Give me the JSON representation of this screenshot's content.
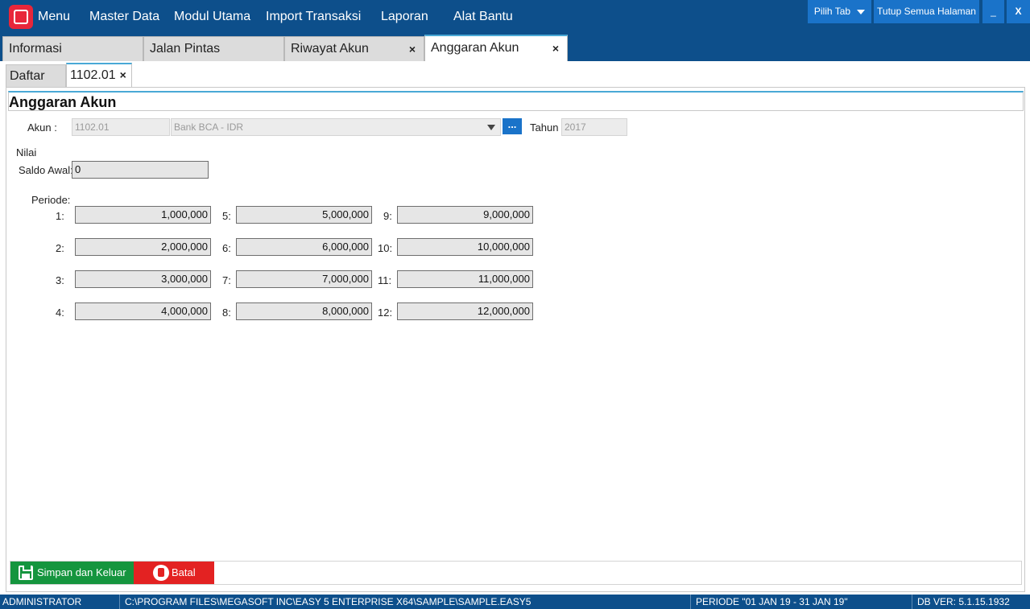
{
  "topbar": {
    "menu_label": "Menu",
    "items": [
      "Master Data",
      "Modul Utama",
      "Import Transaksi",
      "Laporan",
      "Alat Bantu"
    ],
    "pilih_tab": "Pilih Tab",
    "tutup_semua": "Tutup Semua Halaman",
    "minimize": "_",
    "close": "X"
  },
  "main_tabs": [
    {
      "label": "Informasi"
    },
    {
      "label": "Jalan Pintas"
    },
    {
      "label": "Riwayat Akun",
      "close": "×"
    },
    {
      "label": "Anggaran Akun",
      "close": "×"
    }
  ],
  "sub_tabs": [
    {
      "label": "Daftar"
    },
    {
      "label": "1102.01",
      "close": "×"
    }
  ],
  "form": {
    "title": "Anggaran Akun",
    "akun_label": "Akun :",
    "akun_code": "1102.01",
    "akun_name": "Bank BCA - IDR",
    "browse_button": "...",
    "tahun_label": "Tahun",
    "tahun_value": "2017",
    "nilai_label": "Nilai",
    "saldo_awal_label": "Saldo Awal:",
    "saldo_awal_value": "0",
    "periode_label": "Periode:",
    "periods": [
      {
        "label": "1:",
        "value": "1,000,000"
      },
      {
        "label": "2:",
        "value": "2,000,000"
      },
      {
        "label": "3:",
        "value": "3,000,000"
      },
      {
        "label": "4:",
        "value": "4,000,000"
      },
      {
        "label": "5:",
        "value": "5,000,000"
      },
      {
        "label": "6:",
        "value": "6,000,000"
      },
      {
        "label": "7:",
        "value": "7,000,000"
      },
      {
        "label": "8:",
        "value": "8,000,000"
      },
      {
        "label": "9:",
        "value": "9,000,000"
      },
      {
        "label": "10:",
        "value": "10,000,000"
      },
      {
        "label": "11:",
        "value": "11,000,000"
      },
      {
        "label": "12:",
        "value": "12,000,000"
      }
    ]
  },
  "buttons": {
    "save": "Simpan dan Keluar",
    "cancel": "Batal"
  },
  "statusbar": {
    "user": "ADMINISTRATOR",
    "path": "C:\\PROGRAM FILES\\MEGASOFT INC\\EASY 5 ENTERPRISE X64\\SAMPLE\\SAMPLE.EASY5",
    "periode": "PERIODE \"01 JAN 19 - 31 JAN 19\"",
    "db_ver": "DB VER: 5.1.15.1932"
  },
  "colors": {
    "topbar": "#0d4f8b",
    "accent_button": "#1a73c9",
    "save_button": "#15953e",
    "cancel_button": "#e32222",
    "app_icon": "#e8263a"
  }
}
